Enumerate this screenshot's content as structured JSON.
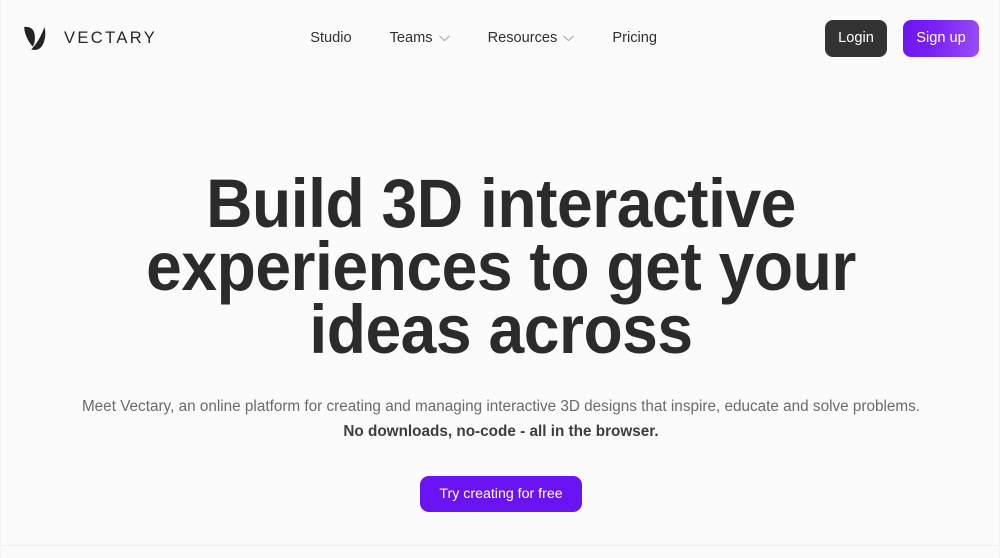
{
  "brand": {
    "logo_icon": "vectary-v-mark-icon",
    "wordmark": "VECTARY"
  },
  "nav": {
    "items": [
      {
        "label": "Studio",
        "has_dropdown": false
      },
      {
        "label": "Teams",
        "has_dropdown": true,
        "icon": "chevron-down-icon"
      },
      {
        "label": "Resources",
        "has_dropdown": true,
        "icon": "chevron-down-icon"
      },
      {
        "label": "Pricing",
        "has_dropdown": false
      }
    ]
  },
  "actions": {
    "login_label": "Login",
    "signup_label": "Sign up"
  },
  "hero": {
    "headline_lines": [
      "Build 3D interactive",
      "experiences to get your",
      "ideas across"
    ],
    "subtitle": "Meet Vectary, an online platform for creating and managing interactive 3D designs that inspire, educate and solve problems.",
    "subtitle_strong": "No downloads, no-code - all in the browser.",
    "cta_label": "Try creating for free"
  },
  "colors": {
    "background": "#fbfbfb",
    "headline": "#2b2b2b",
    "body_text": "#6b6b6b",
    "login_bg": "#333333",
    "signup_gradient_start": "#6d15f0",
    "signup_gradient_end": "#9a4ef8",
    "cta_purple": "#6a14f5"
  }
}
